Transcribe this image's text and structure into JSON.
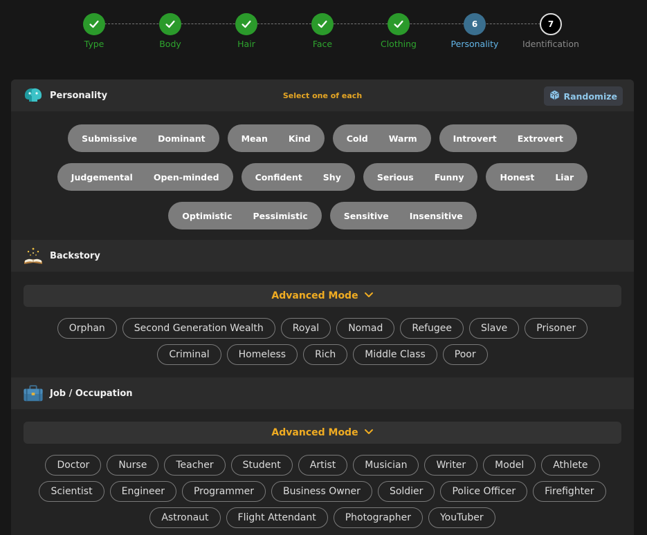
{
  "stepper": {
    "steps": [
      {
        "label": "Type",
        "state": "done"
      },
      {
        "label": "Body",
        "state": "done"
      },
      {
        "label": "Hair",
        "state": "done"
      },
      {
        "label": "Face",
        "state": "done"
      },
      {
        "label": "Clothing",
        "state": "done"
      },
      {
        "label": "Personality",
        "state": "active",
        "number": "6"
      },
      {
        "label": "Identification",
        "state": "future",
        "number": "7"
      }
    ]
  },
  "personality": {
    "title": "Personality",
    "hint": "Select one of each",
    "randomize_label": "Randomize",
    "pairs": [
      [
        "Submissive",
        "Dominant"
      ],
      [
        "Mean",
        "Kind"
      ],
      [
        "Cold",
        "Warm"
      ],
      [
        "Introvert",
        "Extrovert"
      ],
      [
        "Judgemental",
        "Open-minded"
      ],
      [
        "Confident",
        "Shy"
      ],
      [
        "Serious",
        "Funny"
      ],
      [
        "Honest",
        "Liar"
      ],
      [
        "Optimistic",
        "Pessimistic"
      ],
      [
        "Sensitive",
        "Insensitive"
      ]
    ]
  },
  "backstory": {
    "title": "Backstory",
    "advanced_label": "Advanced Mode",
    "options": [
      "Orphan",
      "Second Generation Wealth",
      "Royal",
      "Nomad",
      "Refugee",
      "Slave",
      "Prisoner",
      "Criminal",
      "Homeless",
      "Rich",
      "Middle Class",
      "Poor"
    ]
  },
  "job": {
    "title": "Job / Occupation",
    "advanced_label": "Advanced Mode",
    "options": [
      "Doctor",
      "Nurse",
      "Teacher",
      "Student",
      "Artist",
      "Musician",
      "Writer",
      "Model",
      "Athlete",
      "Scientist",
      "Engineer",
      "Programmer",
      "Business Owner",
      "Soldier",
      "Police Officer",
      "Firefighter",
      "Astronaut",
      "Flight Attendant",
      "Photographer",
      "YouTuber"
    ]
  },
  "icons": {
    "done": "check-icon",
    "personality": "brain-heads-icon",
    "randomize": "dice-icon",
    "backstory": "open-book-icon",
    "job": "briefcase-icon",
    "advanced": "chevron-down-icon"
  },
  "colors": {
    "done": "#2b9a2b",
    "active": "#3a6f8f",
    "accent": "#f0ac22",
    "randomize_text": "#8fc7ea"
  }
}
